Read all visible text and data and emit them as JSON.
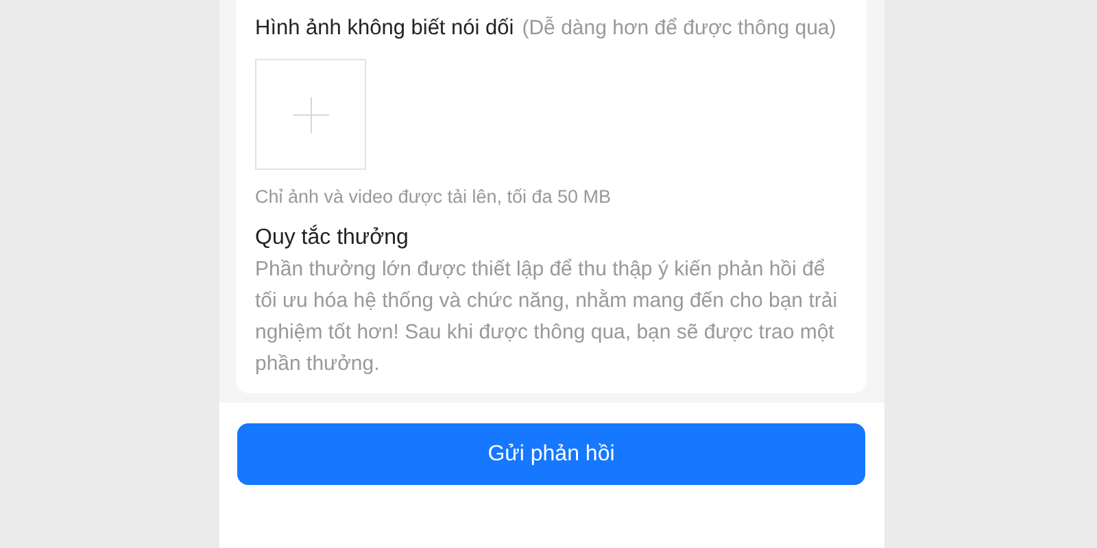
{
  "upload_section": {
    "label": "Hình ảnh không biết nói dối",
    "hint": "(Dễ dàng hơn để được thông qua)",
    "note": "Chỉ ảnh và video được tải lên, tối đa 50 MB"
  },
  "reward_rules": {
    "title": "Quy tắc thưởng",
    "text": "Phần thưởng lớn được thiết lập để thu thập ý kiến phản hồi để tối ưu hóa hệ thống và chức năng, nhằm mang đến cho bạn trải nghiệm tốt hơn! Sau khi được thông qua, bạn sẽ được trao một phần thưởng."
  },
  "submit_button": "Gửi phản hồi"
}
